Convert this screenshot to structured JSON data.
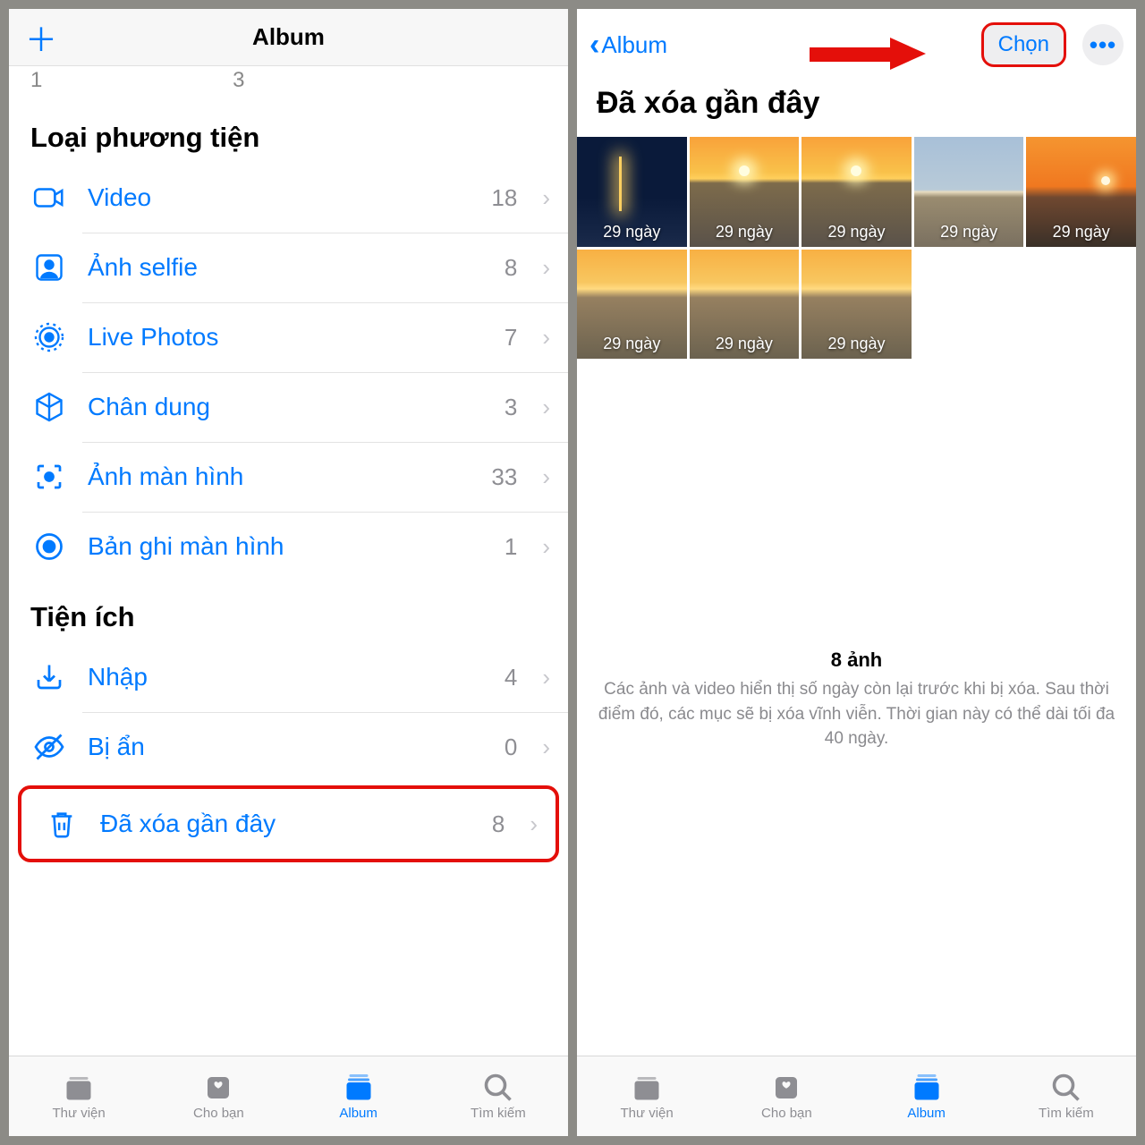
{
  "left": {
    "navbar_title": "Album",
    "top_numbers": [
      "1",
      "3"
    ],
    "section_media": "Loại phương tiện",
    "media_rows": [
      {
        "label": "Video",
        "count": "18"
      },
      {
        "label": "Ảnh selfie",
        "count": "8"
      },
      {
        "label": "Live Photos",
        "count": "7"
      },
      {
        "label": "Chân dung",
        "count": "3"
      },
      {
        "label": "Ảnh màn hình",
        "count": "33"
      },
      {
        "label": "Bản ghi màn hình",
        "count": "1"
      }
    ],
    "section_util": "Tiện ích",
    "util_rows": [
      {
        "label": "Nhập",
        "count": "4"
      },
      {
        "label": "Bị ẩn",
        "count": "0"
      },
      {
        "label": "Đã xóa gần đây",
        "count": "8"
      }
    ]
  },
  "right": {
    "back_label": "Album",
    "select_label": "Chọn",
    "page_title": "Đã xóa gần đây",
    "thumb_badge": "29 ngày",
    "summary_count": "8 ảnh",
    "summary_desc": "Các ảnh và video hiển thị số ngày còn lại trước khi bị xóa. Sau thời điểm đó, các mục sẽ bị xóa vĩnh viễn. Thời gian này có thể dài tối đa 40 ngày."
  },
  "tabs": [
    {
      "label": "Thư viện"
    },
    {
      "label": "Cho bạn"
    },
    {
      "label": "Album"
    },
    {
      "label": "Tìm kiếm"
    }
  ]
}
